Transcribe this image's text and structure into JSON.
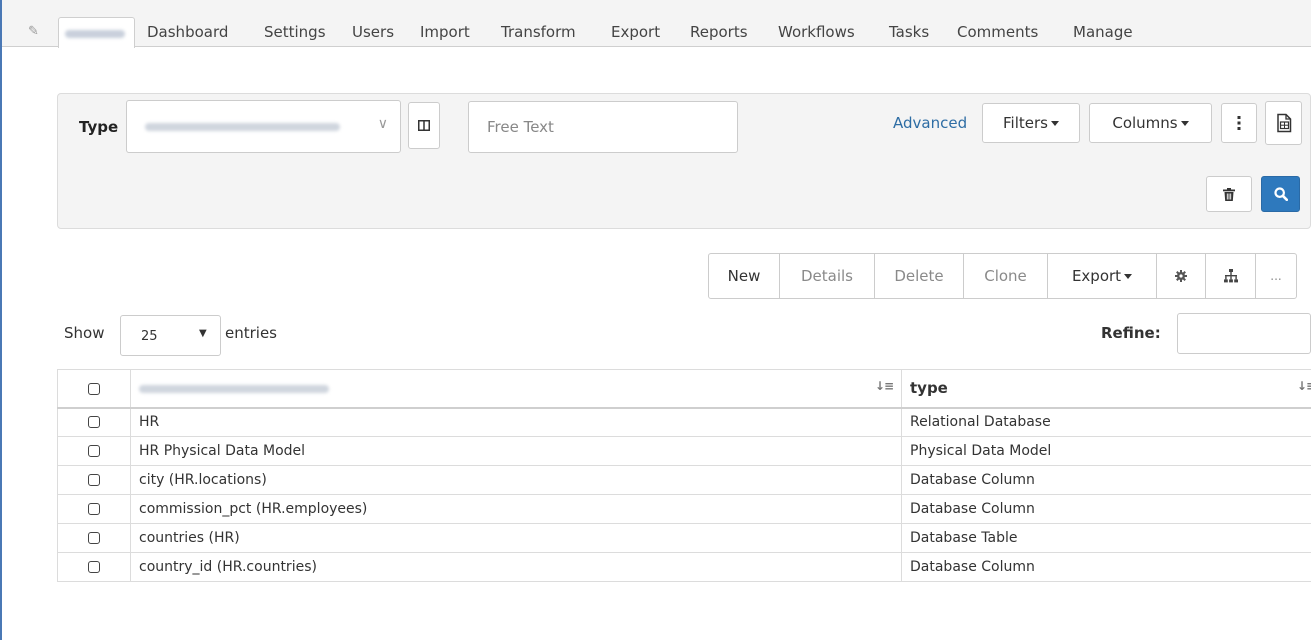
{
  "tabs": {
    "items": [
      "Dashboard",
      "Settings",
      "Users",
      "Import",
      "Transform",
      "Export",
      "Reports",
      "Workflows",
      "Tasks",
      "Comments",
      "Manage"
    ]
  },
  "search": {
    "type_label": "Type",
    "free_text_placeholder": "Free Text",
    "advanced_label": "Advanced",
    "filters_label": "Filters",
    "columns_label": "Columns"
  },
  "toolbar": {
    "new_label": "New",
    "details_label": "Details",
    "delete_label": "Delete",
    "clone_label": "Clone",
    "export_label": "Export",
    "more_label": "..."
  },
  "list": {
    "show_label": "Show",
    "entries_value": "25",
    "entries_label": "entries",
    "refine_label": "Refine:"
  },
  "table": {
    "col2_header": "type",
    "rows": [
      {
        "name": "HR",
        "type": "Relational Database"
      },
      {
        "name": "HR Physical Data Model",
        "type": "Physical Data Model"
      },
      {
        "name": "city (HR.locations)",
        "type": "Database Column"
      },
      {
        "name": "commission_pct (HR.employees)",
        "type": "Database Column"
      },
      {
        "name": "countries (HR)",
        "type": "Database Table"
      },
      {
        "name": "country_id (HR.countries)",
        "type": "Database Column"
      }
    ]
  },
  "icons": {
    "edit": "pencil-icon",
    "columns_toggle": "columns-icon",
    "more_vertical": "kebab-icon",
    "export_file": "file-export-icon",
    "trash": "trash-icon",
    "search": "search-icon",
    "settings": "gear-icon",
    "hierarchy": "hierarchy-icon",
    "sort": "sort-icon"
  },
  "colors": {
    "accent": "#2e79bd",
    "link": "#2e6da4",
    "rail": "#4a78b5"
  }
}
